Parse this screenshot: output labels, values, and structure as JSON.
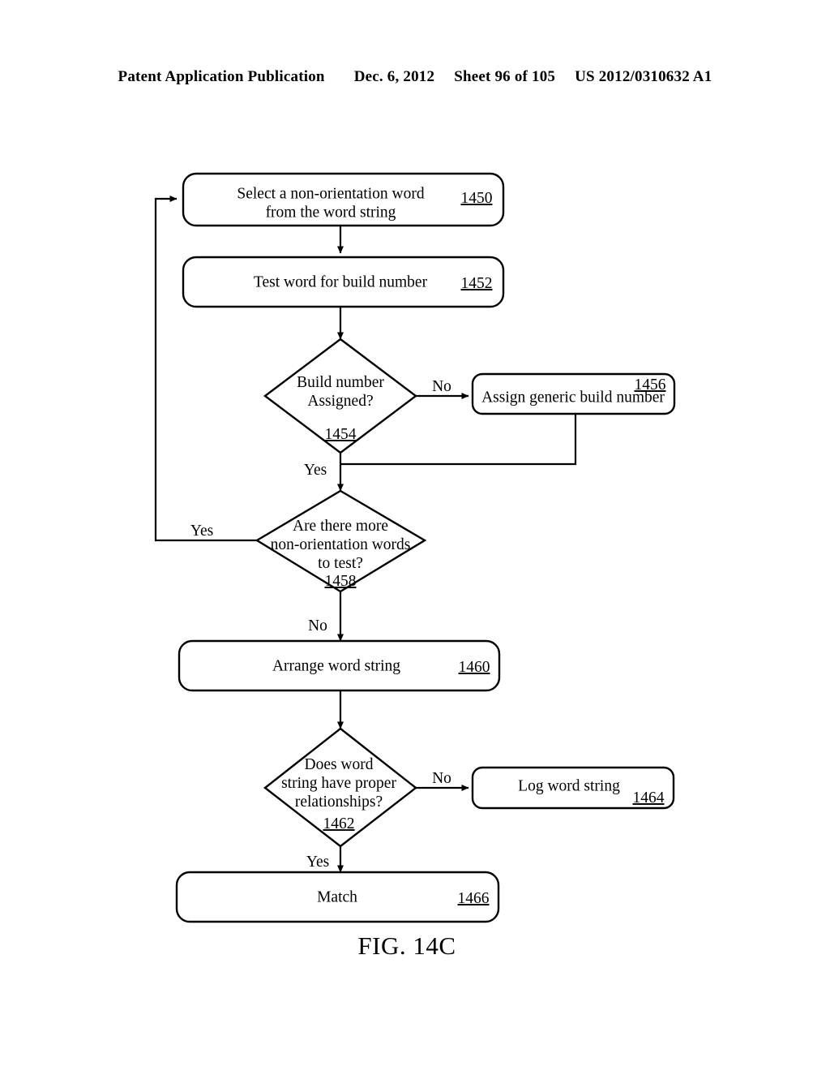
{
  "header": {
    "publication": "Patent Application Publication",
    "date": "Dec. 6, 2012",
    "sheet": "Sheet 96 of 105",
    "patent_number": "US 2012/0310632 A1"
  },
  "figure": {
    "caption": "FIG. 14C"
  },
  "nodes": {
    "select_word": {
      "line1": "Select a non-orientation word",
      "line2": "from the word string",
      "ref": "1450"
    },
    "test_word": {
      "line1": "Test word for build number",
      "ref": "1452"
    },
    "build_assigned": {
      "line1": "Build number",
      "line2": "Assigned?",
      "ref": "1454"
    },
    "assign_generic": {
      "line1": "Assign generic build number",
      "ref": "1456"
    },
    "more_words": {
      "line1": "Are there more",
      "line2": "non-orientation words",
      "line3": "to test?",
      "ref": "1458"
    },
    "arrange_string": {
      "line1": "Arrange word string",
      "ref": "1460"
    },
    "proper_relationships": {
      "line1": "Does word",
      "line2": "string have proper",
      "line3": "relationships?",
      "ref": "1462"
    },
    "log_string": {
      "line1": "Log word string",
      "ref": "1464"
    },
    "match": {
      "line1": "Match",
      "ref": "1466"
    }
  },
  "edges": {
    "build_assigned_no": "No",
    "build_assigned_yes": "Yes",
    "more_words_yes": "Yes",
    "more_words_no": "No",
    "relationships_no": "No",
    "relationships_yes": "Yes"
  },
  "colors": {
    "ink": "#000000",
    "paper": "#ffffff"
  }
}
